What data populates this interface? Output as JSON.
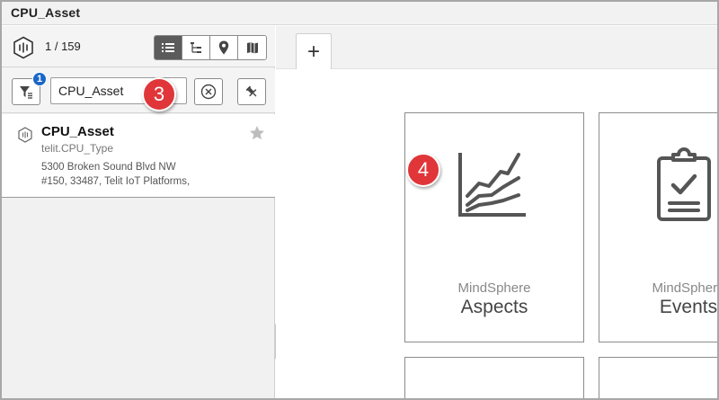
{
  "window": {
    "title": "CPU_Asset"
  },
  "left": {
    "count": "1 / 159",
    "view_buttons": [
      {
        "name": "list",
        "icon": "list-icon",
        "active": true
      },
      {
        "name": "tree",
        "icon": "tree-icon",
        "active": false
      },
      {
        "name": "location",
        "icon": "location-pin-icon",
        "active": false
      },
      {
        "name": "map",
        "icon": "map-icon",
        "active": false
      }
    ],
    "filter_badge": "1",
    "search": {
      "value": "CPU_Asset"
    },
    "asset": {
      "name": "CPU_Asset",
      "type": "telit.CPU_Type",
      "address_line1": "5300 Broken Sound Blvd NW",
      "address_line2": "#150, 33487, Telit IoT Platforms,"
    }
  },
  "callouts": {
    "step3": "3",
    "step4": "4"
  },
  "tabs": {
    "add_label": "+"
  },
  "tiles": [
    {
      "subtitle": "MindSphere",
      "title": "Aspects",
      "icon": "chart-lines-icon"
    },
    {
      "subtitle": "MindSphere",
      "title": "Events",
      "icon": "clipboard-check-icon"
    }
  ],
  "colors": {
    "badge": "#1a66c9",
    "callout": "#e0363a",
    "active_view": "#5b5b5b"
  }
}
